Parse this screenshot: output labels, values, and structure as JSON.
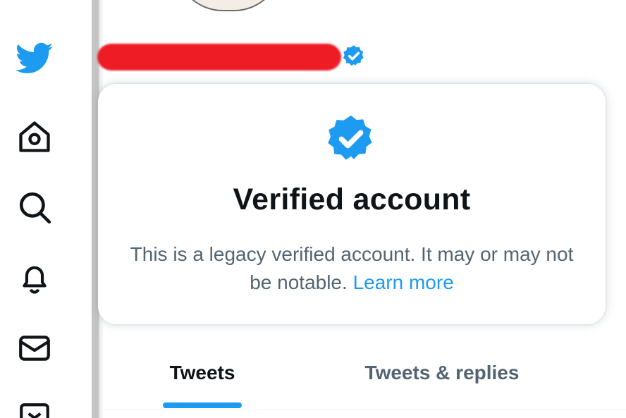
{
  "colors": {
    "brand_blue": "#1d9bf0",
    "text_primary": "#0f1419",
    "text_secondary": "#536471",
    "redaction_red": "#ee1c25"
  },
  "nav": {
    "items": [
      {
        "icon": "twitter-bird-icon"
      },
      {
        "icon": "home-icon"
      },
      {
        "icon": "search-icon"
      },
      {
        "icon": "notifications-bell-icon"
      },
      {
        "icon": "messages-envelope-icon"
      },
      {
        "icon": "bookmarks-icon"
      }
    ]
  },
  "profile": {
    "name_redacted": true,
    "verified_badge_icon": "verified-badge-icon"
  },
  "popover": {
    "badge_icon": "verified-badge-icon",
    "title": "Verified account",
    "body_text": "This is a legacy verified account. It may or may not be notable.",
    "link_text": "Learn more"
  },
  "tabs": [
    {
      "label": "Tweets",
      "selected": true
    },
    {
      "label": "Tweets & replies",
      "selected": false
    }
  ]
}
